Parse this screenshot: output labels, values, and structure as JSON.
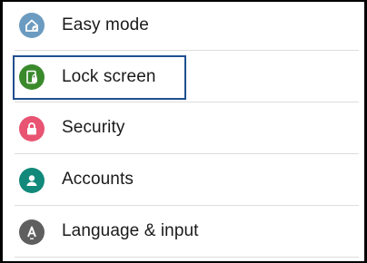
{
  "settings": {
    "items": [
      {
        "label": "Easy mode",
        "icon": "easy-mode-icon",
        "color": "#6b9bc0"
      },
      {
        "label": "Lock screen",
        "icon": "lock-screen-icon",
        "color": "#3a8a2c"
      },
      {
        "label": "Security",
        "icon": "security-lock-icon",
        "color": "#e85472"
      },
      {
        "label": "Accounts",
        "icon": "account-person-icon",
        "color": "#12897a"
      },
      {
        "label": "Language & input",
        "icon": "language-a-icon",
        "color": "#5f5f5f"
      }
    ]
  },
  "highlight_color": "#1f4f8f"
}
